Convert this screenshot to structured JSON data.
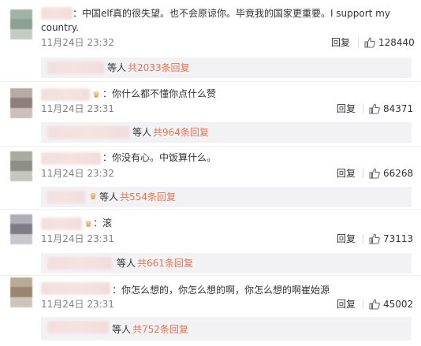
{
  "comments": [
    {
      "text_line1": "：中国elf真的很失望。也不会原谅你。毕竟我的国家更重要。I support my",
      "text_line2": "country.",
      "time": "11月24日 23:32",
      "reply_label": "回复",
      "likes": "128440",
      "sub_prefix": "等人",
      "sub_count": "共2033条回复",
      "avatar_colors": [
        "#9fb3a6",
        "#8ca192",
        "#c4cbc6"
      ]
    },
    {
      "text_line1": "：你什么都不懂你点什么赞",
      "time": "11月24日 23:31",
      "reply_label": "回复",
      "likes": "84371",
      "sub_prefix": "等人",
      "sub_count": "共964条回复",
      "avatar_colors": [
        "#b7a9a4",
        "#8f7e79",
        "#cdbfbc"
      ]
    },
    {
      "text_line1": "：你没有心。中饭算什么。",
      "time": "11月24日 23:32",
      "reply_label": "回复",
      "likes": "66268",
      "sub_prefix": "等人",
      "sub_count": "共554条回复",
      "avatar_colors": [
        "#a9aba2",
        "#8d8e86",
        "#c5c6bf"
      ]
    },
    {
      "text_line1": "：滚",
      "time": "11月24日 23:31",
      "reply_label": "回复",
      "likes": "73113",
      "sub_prefix": "等人",
      "sub_count": "共661条回复",
      "avatar_colors": [
        "#b0aeb6",
        "#7e7c86",
        "#c9c7cd"
      ]
    },
    {
      "text_line1": "：你怎么想的，你怎么想的啊，你怎么想的啊崔始源",
      "time": "11月24日 23:31",
      "reply_label": "回复",
      "likes": "45002",
      "sub_prefix": "等人",
      "sub_count": "共752条回复",
      "avatar_colors": [
        "#b9aa98",
        "#9a8670",
        "#cfc4b7"
      ]
    }
  ]
}
